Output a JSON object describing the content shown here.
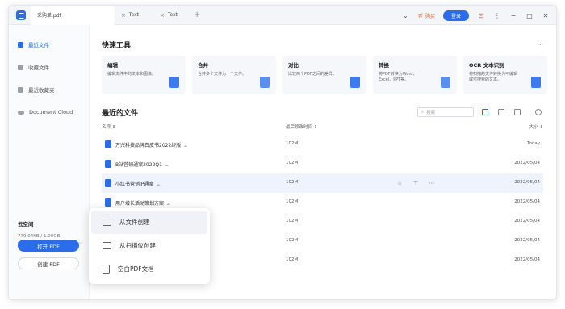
{
  "titlebar": {
    "active_tab": "采购单.pdf",
    "tabs": [
      "Text",
      "Text"
    ],
    "cart_label": "购买",
    "login_label": "登录"
  },
  "sidebar": {
    "items": [
      {
        "label": "最近文件",
        "icon": "recent-file-icon"
      },
      {
        "label": "收藏文件",
        "icon": "star-file-icon"
      },
      {
        "label": "最近收藏夹",
        "icon": "folder-icon"
      },
      {
        "label": "Document Cloud",
        "icon": "cloud-icon"
      }
    ],
    "storage_title": "云空间",
    "storage_value": "779.04KB / 1.00GB",
    "storage_fraction": 0.45,
    "open_label": "打开 PDF",
    "create_label": "创建 PDF"
  },
  "quick_tools": {
    "title": "快速工具",
    "more": "...",
    "cards": [
      {
        "title": "编辑",
        "desc": "编辑文件中的文本和图像。"
      },
      {
        "title": "合并",
        "desc": "合并多个文件为一个文件。"
      },
      {
        "title": "对比",
        "desc": "比较两个PDF之间的差异。"
      },
      {
        "title": "转换",
        "desc": "将PDF转换为Word、Excel、PPT等。"
      },
      {
        "title": "OCR 文本识别",
        "desc": "将扫描的文件转换为可编辑或可搜索的文本。"
      }
    ]
  },
  "recent": {
    "title": "最近的文件",
    "search_placeholder": "搜索",
    "col_name": "名称 ⇕",
    "col_modified": "最后修改时间 ⇕",
    "col_size": "大小 ⇕",
    "files": [
      {
        "name": "万兴科技品牌白皮书2022终版",
        "size": "102M",
        "date": "Today"
      },
      {
        "name": "B站营销通案2022Q1",
        "size": "102M",
        "date": "2022/05/04"
      },
      {
        "name": "小红书营销IP通案",
        "size": "102M",
        "date": "2022/05/04"
      },
      {
        "name": "用户增长活动策划方案",
        "size": "102M",
        "date": "2022/05/04"
      },
      {
        "name": "",
        "size": "102M",
        "date": "2022/05/04"
      },
      {
        "name": "",
        "size": "102M",
        "date": "2022/05/04"
      },
      {
        "name": "",
        "size": "102M",
        "date": "2022/05/04"
      }
    ]
  },
  "popup": {
    "items": [
      "从文件创建",
      "从扫描仪创建",
      "空白PDF文档"
    ]
  },
  "colors": {
    "accent": "#2b6de8",
    "cart": "#e8632b"
  }
}
